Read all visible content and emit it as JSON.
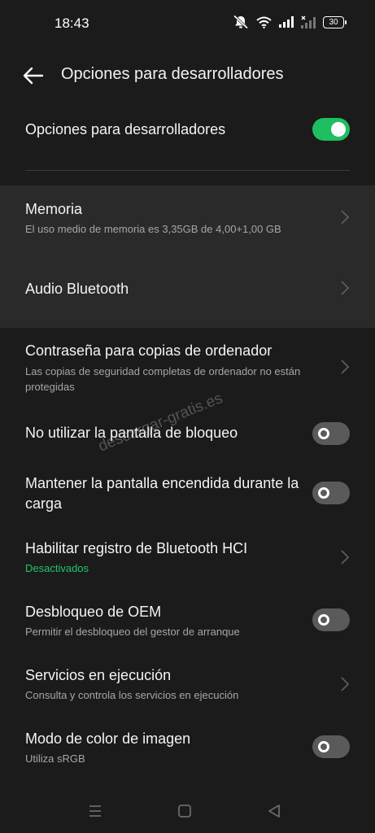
{
  "status": {
    "time": "18:43",
    "battery": "30",
    "icons": [
      "mute-icon",
      "wifi-icon",
      "signal-icon",
      "signal-nosim-icon",
      "battery-icon"
    ]
  },
  "header": {
    "title": "Opciones para desarrolladores",
    "back_icon": "back-arrow-icon"
  },
  "master": {
    "label": "Opciones para desarrolladores",
    "enabled": true
  },
  "items": [
    {
      "title": "Memoria",
      "subtitle": "El uso medio de memoria es 3,35GB de 4,00+1,00 GB",
      "control": "chevron"
    },
    {
      "title": "Audio Bluetooth",
      "subtitle": "",
      "control": "chevron"
    },
    {
      "title": "Contraseña para copias de ordenador",
      "subtitle": "Las copias de seguridad completas de ordenador no están protegidas",
      "control": "chevron"
    },
    {
      "title": "No utilizar la pantalla de bloqueo",
      "subtitle": "",
      "control": "toggle",
      "enabled": false
    },
    {
      "title": "Mantener la pantalla encendida durante la carga",
      "subtitle": "",
      "control": "toggle",
      "enabled": false
    },
    {
      "title": "Habilitar registro de Bluetooth HCI",
      "subtitle": "Desactivados",
      "control": "chevron"
    },
    {
      "title": "Desbloqueo de OEM",
      "subtitle": "Permitir el desbloqueo del gestor de arranque",
      "control": "toggle",
      "enabled": false
    },
    {
      "title": "Servicios en ejecución",
      "subtitle": "Consulta y controla los servicios en ejecución",
      "control": "chevron"
    },
    {
      "title": "Modo de color de imagen",
      "subtitle": "Utiliza sRGB",
      "control": "toggle",
      "enabled": false
    }
  ],
  "watermark": "descargar-gratis.es",
  "colors": {
    "background": "#1b1b1b",
    "highlight": "#2a2a2a",
    "accent_green": "#1fbe60",
    "toggle_off": "#5a5a5a"
  },
  "navbar": {
    "icons": [
      "menu-icon",
      "home-icon",
      "back-icon"
    ]
  }
}
